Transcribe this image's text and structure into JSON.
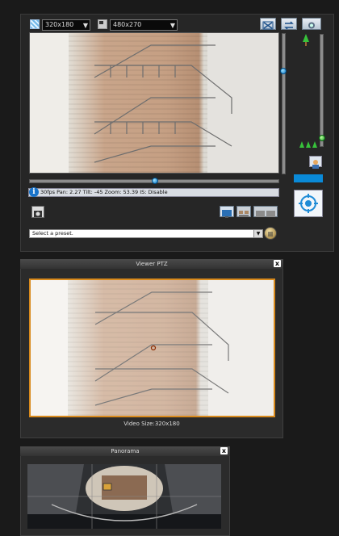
{
  "main": {
    "size_select_1": "320x180",
    "size_select_2": "480x270",
    "status_text": "30fps Pan: 2.27 Tilt: -45 Zoom: 53.39 IS: Disable",
    "preset_placeholder": "Select a preset.",
    "info_glyph": "i"
  },
  "viewer_ptz": {
    "title": "Viewer PTZ",
    "video_size": "Video Size:320x180",
    "close_glyph": "x"
  },
  "panorama": {
    "title": "Panorama",
    "close_glyph": "x"
  },
  "colors": {
    "accent_blue": "#0b77c8",
    "orange_frame": "#d98a1c",
    "preset_bar_blue": "#0a8ad8"
  },
  "icons": [
    "aspect-icon",
    "resize-icon",
    "fit-screen-icon",
    "swap-icon",
    "camera-rotate-icon",
    "tree-icon",
    "trees-icon",
    "person-icon",
    "crosshair-icon",
    "snapshot-icon",
    "monitor-icon",
    "view-mode-icon",
    "layout-icon",
    "preset-menu-icon",
    "close-icon",
    "chevron-down-icon"
  ]
}
